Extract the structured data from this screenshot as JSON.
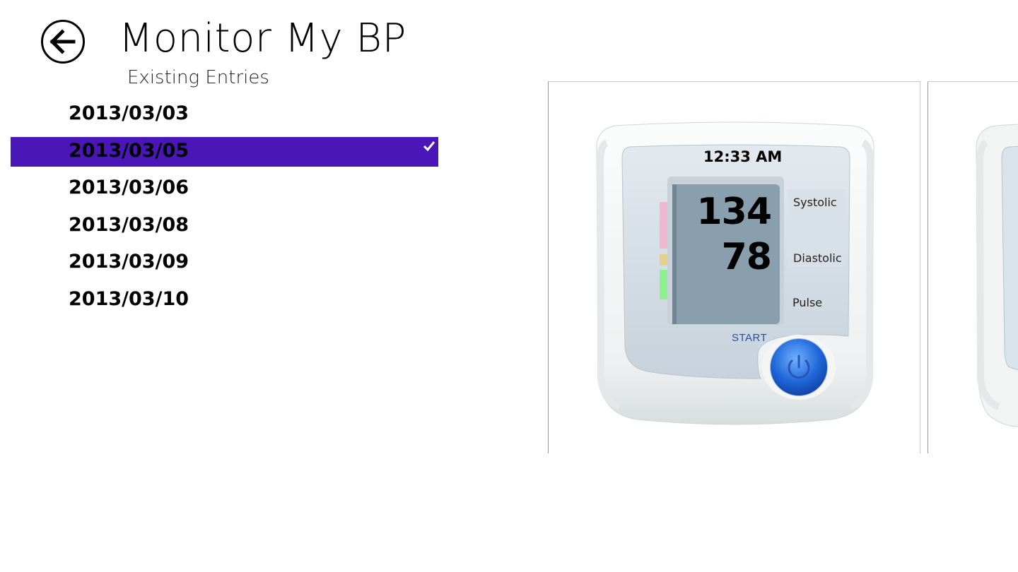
{
  "header": {
    "title": "Monitor My BP",
    "subtitle": "Existing Entries"
  },
  "entries": [
    {
      "date": "2013/03/03",
      "selected": false
    },
    {
      "date": "2013/03/05",
      "selected": true
    },
    {
      "date": "2013/03/06",
      "selected": false
    },
    {
      "date": "2013/03/08",
      "selected": false
    },
    {
      "date": "2013/03/09",
      "selected": false
    },
    {
      "date": "2013/03/10",
      "selected": false
    }
  ],
  "reading": {
    "time": "12:33 AM",
    "systolic": "134",
    "diastolic": "78",
    "systolic_label": "Systolic",
    "diastolic_label": "Diastolic",
    "pulse_label": "Pulse",
    "start_label": "START"
  },
  "colors": {
    "selection": "#4a16b8",
    "start_text": "#2b4aa5",
    "power_button": "#1e66d8",
    "indicator_high": "#f0b7d0",
    "indicator_mid": "#e5d08a",
    "indicator_normal": "#8ef08e"
  },
  "icons": {
    "back": "back-arrow-icon",
    "check": "checkmark-icon",
    "power": "power-icon"
  }
}
